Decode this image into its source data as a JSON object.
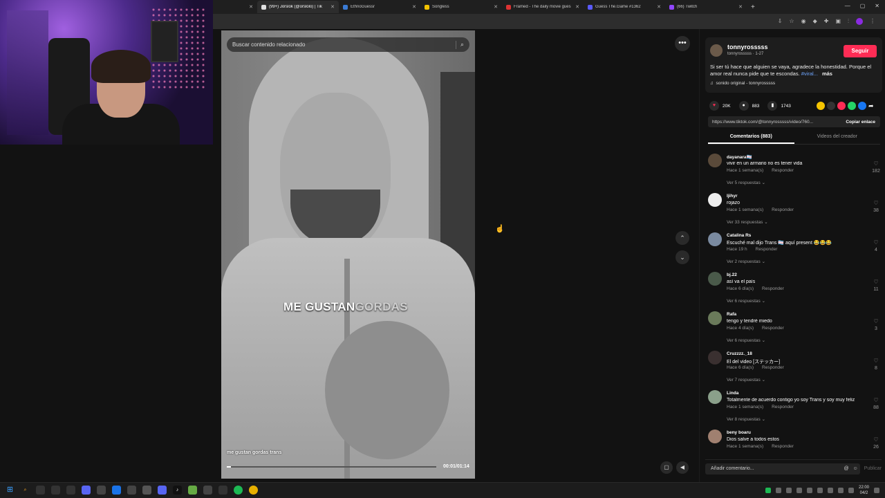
{
  "browser": {
    "tabs": [
      {
        "title": "(99+) Jorslok (@orslolo) | Tik",
        "fav": "#e0e0e0",
        "active": true
      },
      {
        "title": "EthnoGuessr",
        "fav": "#3a7bd5",
        "active": false
      },
      {
        "title": "Songless",
        "fav": "#f2c200",
        "active": false
      },
      {
        "title": "Framed - The daily movie gues",
        "fav": "#d33",
        "active": false
      },
      {
        "title": "Guess The.Game #1362",
        "fav": "#5a5aff",
        "active": false
      },
      {
        "title": "(66) Twitch",
        "fav": "#9146ff",
        "active": false
      }
    ]
  },
  "video": {
    "search_placeholder": "Buscar contenido relacionado",
    "caption_main": "ME GUSTAN",
    "caption_faded": "GORDAS",
    "subtitle": "me gustan gordas trans",
    "time": "00:01/01:14",
    "progress": 0.02
  },
  "author": {
    "name": "tonnyrosssss",
    "subline": "tonnyrosssss · 1-27",
    "follow_label": "Seguir",
    "description": "Si ser tú hace que alguien se vaya, agradece la honestidad. Porque el amor real nunca pide que te escondas.",
    "hashtag": "#viral...",
    "more_label": "más",
    "sound": "sonido original - tonnyrosssss"
  },
  "stats": {
    "likes": "20K",
    "comments": "883",
    "saves": "1743"
  },
  "link": {
    "url": "https://www.tiktok.com/@tonnyrosssss/video/760...",
    "copy_label": "Copiar enlace"
  },
  "panel_tabs": {
    "comments": "Comentarios (883)",
    "creator_videos": "Videos del creador"
  },
  "comments": [
    {
      "user": "dayanara🏳️‍⚧️",
      "text": "vivir en un armario no es tener vida",
      "time": "Hace 1 semana(s)",
      "replies": "Ver 5 respuestas",
      "likes": "182",
      "color": "#5a4a3a"
    },
    {
      "user": "ljihyr",
      "text": "rojazo",
      "time": "Hace 1 semana(s)",
      "replies": "Ver 33 respuestas",
      "likes": "38",
      "color": "#eeeeee"
    },
    {
      "user": "Catalina Rs",
      "text": "Escuché mal dijo Trans 🏳️‍⚧️ aquí present 😂😂😂",
      "time": "Hace 19 h",
      "replies": "Ver 2 respuestas",
      "likes": "4",
      "color": "#7a8aa0"
    },
    {
      "user": "bj.22",
      "text": "así va el país",
      "time": "Hace 6 día(s)",
      "replies": "Ver 6 respuestas",
      "likes": "11",
      "color": "#4a5a4a"
    },
    {
      "user": "Rafa",
      "text": "tengo y tendré miedo",
      "time": "Hace 4 día(s)",
      "replies": "Ver 6 respuestas",
      "likes": "3",
      "color": "#6a7a5a"
    },
    {
      "user": "Cruzzzz._18",
      "text": "El del video [ステッカー]",
      "time": "Hace 6 día(s)",
      "replies": "Ver 7 respuestas",
      "likes": "8",
      "color": "#3a3030"
    },
    {
      "user": "Linda",
      "text": "Totalmente de acuerdo contigo yo soy Trans y soy muy feliz",
      "time": "Hace 1 semana(s)",
      "replies": "Ver 8 respuestas",
      "likes": "88",
      "color": "#8aa08a"
    },
    {
      "user": "beny boaru",
      "text": "Dios salve a todos estos",
      "time": "Hace 1 semana(s)",
      "replies": "",
      "likes": "26",
      "color": "#a08070"
    }
  ],
  "reply_label": "Responder",
  "add_comment": {
    "placeholder": "Añadir comentario...",
    "publish_label": "Publicar"
  },
  "taskbar": {
    "time": "22:00",
    "date": "04/2"
  }
}
